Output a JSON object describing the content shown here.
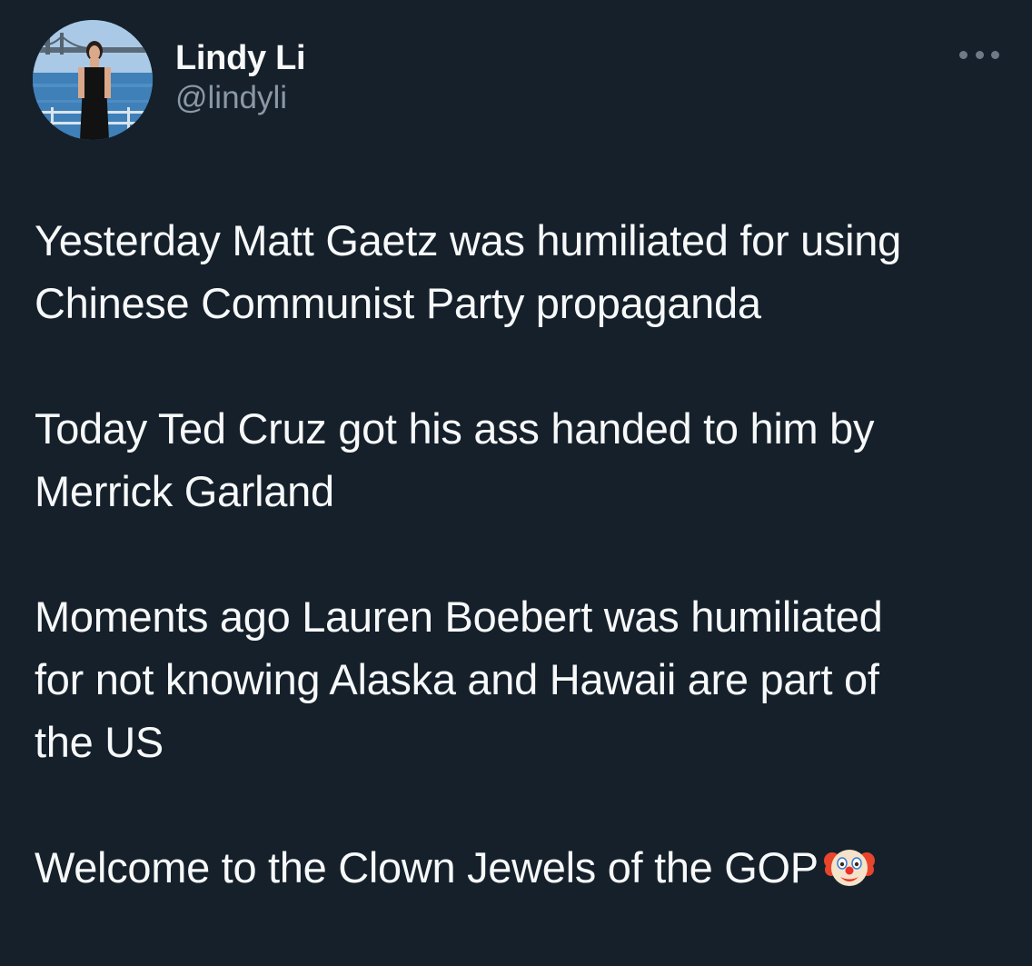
{
  "author": {
    "display_name": "Lindy Li",
    "handle": "@lindyli"
  },
  "tweet": {
    "paragraphs": [
      "Yesterday Matt Gaetz was humiliated for using\nChinese Communist Party propaganda",
      "Today Ted Cruz got his ass handed to him by\nMerrick Garland",
      "Moments ago Lauren Boebert was humiliated\nfor not knowing Alaska and Hawaii are part of\nthe US",
      "Welcome to the Clown Jewels of the GOP"
    ],
    "trailing_emoji": "clown-face-emoji"
  },
  "icons": {
    "more": "more-options-icon"
  },
  "colors": {
    "background": "#15202b",
    "primary_text": "#f7f9f9",
    "secondary_text": "#8b98a5"
  }
}
